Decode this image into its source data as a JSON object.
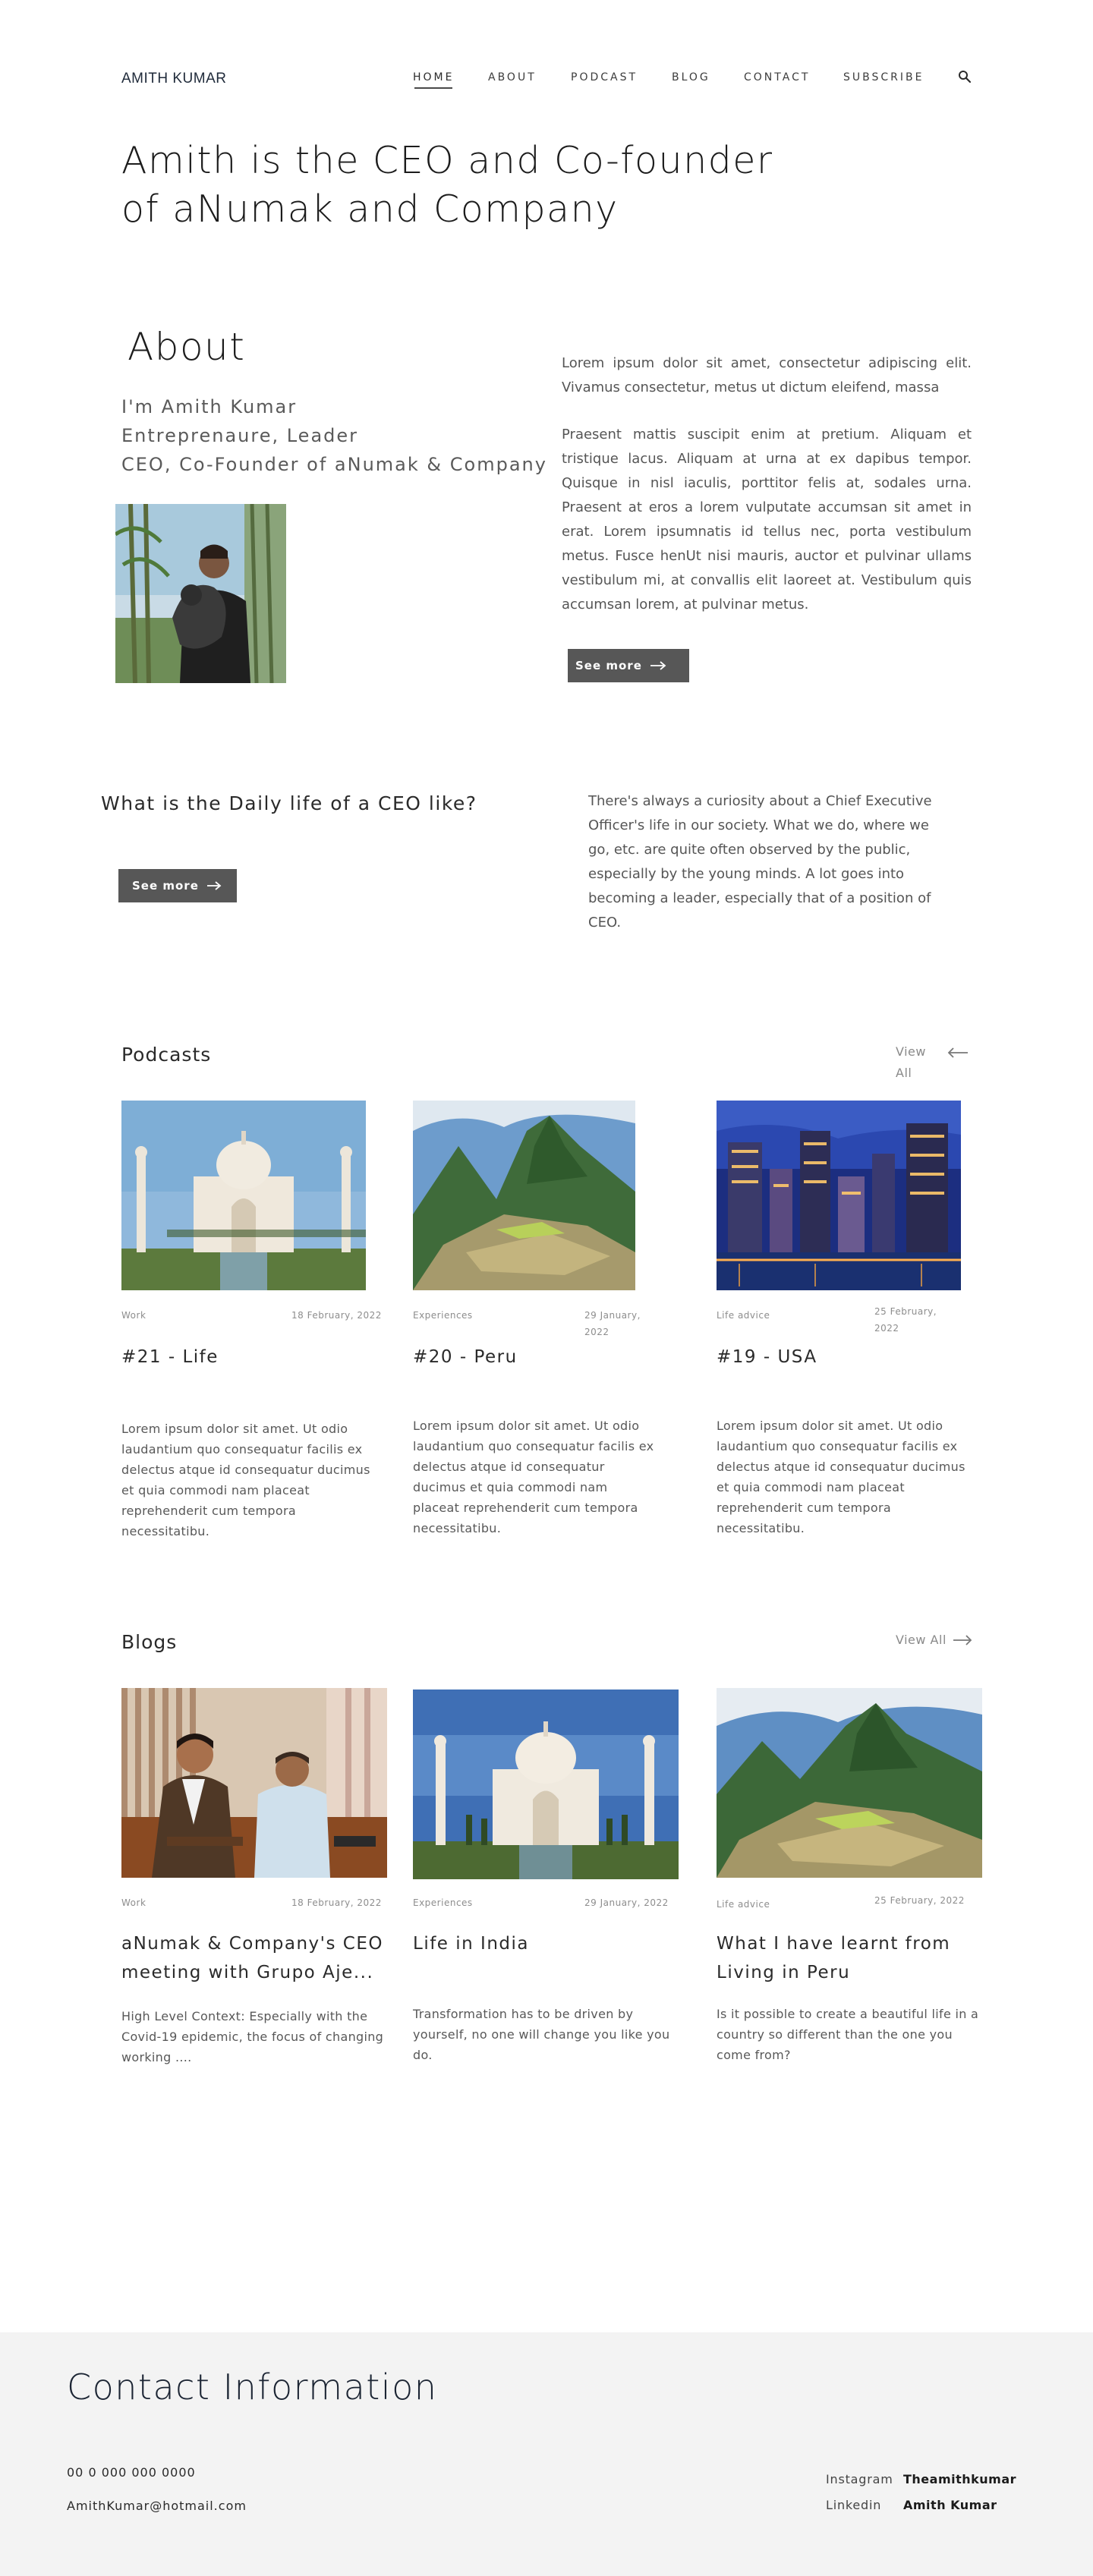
{
  "header": {
    "brand": "AMITH KUMAR",
    "nav": [
      "HOME",
      "ABOUT",
      "PODCAST",
      "BLOG",
      "CONTACT",
      "SUBSCRIBE"
    ],
    "active": "HOME",
    "search_icon": "search-icon"
  },
  "hero": {
    "title_line1": "Amith is the CEO and Co-founder",
    "title_line2": "of aNumak and Company"
  },
  "about": {
    "heading": "About",
    "intro": "I'm Amith Kumar",
    "roles": "Entreprenaure, Leader",
    "position": "CEO, Co-Founder of aNumak & Company",
    "paragraph1": "Lorem ipsum dolor sit amet, consectetur adipiscing elit. Vivamus consectetur, metus ut dictum eleifend, massa",
    "paragraph2": "Praesent mattis suscipit enim at pretium. Aliquam et tristique lacus. Aliquam at urna at ex dapibus tempor. Quisque in nisl iaculis, porttitor felis at, sodales urna. Praesent at eros a lorem vulputate accumsan sit amet in erat. Lorem ipsumnatis id tellus nec, porta vestibulum metus. Fusce henUt nisi mauris, auctor et pulvinar ullams vestibulum mi, at convallis elit laoreet at. Vestibulum quis accumsan lorem, at pulvinar metus.",
    "button": "See more"
  },
  "ceo": {
    "question": "What is the Daily life of a CEO like?",
    "button": "See more",
    "text": "There's always a curiosity about a Chief Executive Officer's life in our society. What we do, where we go, etc. are quite often observed by  the public, especially by the young minds. A lot goes into becoming a leader, especially that of a position of CEO."
  },
  "podcasts": {
    "title": "Podcasts",
    "view_all_line1": "View",
    "view_all_line2": "All",
    "items": [
      {
        "category": "Work",
        "date": "18 February, 2022",
        "title": "#21 - Life",
        "desc": "Lorem ipsum dolor sit amet. Ut odio laudantium quo consequatur facilis ex delectus atque id consequatur ducimus et quia commodi nam placeat reprehenderit cum tempora necessitatibu."
      },
      {
        "category": "Experiences",
        "date_line1": "29 January,",
        "date_line2": "2022",
        "title": "#20 - Peru",
        "desc": "Lorem ipsum dolor sit amet. Ut odio laudantium quo consequatur facilis ex delectus atque id consequatur ducimus et quia commodi nam placeat reprehenderit cum tempora necessitatibu."
      },
      {
        "category": "Life advice",
        "date_line1": "25 February,",
        "date_line2": "2022",
        "title": "#19 - USA",
        "desc": "Lorem ipsum dolor sit amet. Ut odio laudantium quo consequatur facilis ex delectus atque id consequatur ducimus et quia commodi nam placeat reprehenderit cum tempora necessitatibu."
      }
    ]
  },
  "blogs": {
    "title": "Blogs",
    "view_all": "View All",
    "items": [
      {
        "category": "Work",
        "date": "18 February, 2022",
        "title_line1": "aNumak & Company's CEO",
        "title_line2": "meeting with Grupo Aje...",
        "desc": "High Level Context: Especially with the Covid-19 epidemic, the focus of changing working ...."
      },
      {
        "category": "Experiences",
        "date": "29 January, 2022",
        "title_line1": "Life in India",
        "desc": "Transformation has to be driven by yourself, no one will change you like you do."
      },
      {
        "category": "Life advice",
        "date": "25 February, 2022",
        "title_line1": "What I have learnt from",
        "title_line2": "Living in Peru",
        "desc": "Is it possible to create a beautiful life in a country so different than the one you come from?"
      }
    ]
  },
  "contact": {
    "title": "Contact Information",
    "phone": "00 0 000 000 0000",
    "email": "AmithKumar@hotmail.com",
    "instagram_label": "Instagram",
    "instagram_value": "Theamithkumar",
    "linkedin_label": "Linkedin",
    "linkedin_value": "Amith Kumar"
  }
}
